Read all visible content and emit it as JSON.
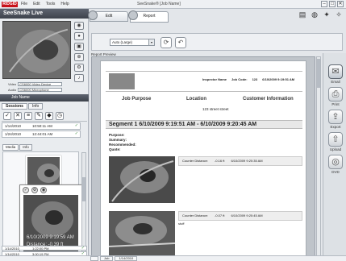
{
  "app": {
    "brand": "RIDGID",
    "menu": [
      "File",
      "Edit",
      "Tools",
      "Help"
    ],
    "window_title": "SeeSnake® [Job Name]",
    "window_buttons": [
      "‒",
      "□",
      "✕"
    ]
  },
  "live": {
    "title": "SeeSnake Live",
    "video_label": "Video",
    "video_source": "CS6000 Video Device",
    "audio_label": "Audio",
    "audio_source": "CS6000 Microphone"
  },
  "job": {
    "header": "Job Name",
    "tabs": [
      "Sessions",
      "Info"
    ],
    "sessions_top": [
      {
        "date": "1/14/2010",
        "time": "10:50:11 AM"
      },
      {
        "date": "1/24/2010",
        "time": "12:44:01 AM"
      }
    ],
    "media_tabs": [
      "Media",
      "Info"
    ],
    "thumb_caption_date": "6/10/2009 9:19:59 AM",
    "thumb_caption_distance": "Distance: -0.39 ft",
    "sessions_bottom": [
      {
        "date": "1/14/2010",
        "time": "1:22:00 PM"
      },
      {
        "date": "1/14/2010",
        "time": "3:00:19 PM"
      }
    ]
  },
  "main": {
    "tabs": [
      "Edit",
      "Report"
    ],
    "active_tab": "Report",
    "report_template": "Auto (Large)",
    "preview_label": "Report Preview"
  },
  "report": {
    "header_fields": [
      "Inspector Name",
      "Job Code:",
      "123",
      "6/10/2009 9:19:51 AM"
    ],
    "col_job_purpose": "Job Purpose",
    "col_location": "Location",
    "col_customer": "Customer Information",
    "address": "123 street street",
    "segment_title": "Segment 1  6/10/2009 9:19:51 AM  -  6/10/2009 9:20:45 AM",
    "segment_fields": [
      "Purpose:",
      "Summary:",
      "Recommended:",
      "Quote:"
    ],
    "observations": [
      {
        "counter": "Counter Distance:",
        "distance": "-0.16 ft",
        "time": "6/10/2009 9:20:35 AM",
        "note": ""
      },
      {
        "counter": "Counter Distance:",
        "distance": "-0.07 ft",
        "time": "6/10/2009 9:20:45 AM",
        "note": "stuff"
      }
    ]
  },
  "actions": [
    {
      "icon": "email-icon",
      "label": "Email"
    },
    {
      "icon": "print-icon",
      "label": "Print"
    },
    {
      "icon": "export-icon",
      "label": "Export"
    },
    {
      "icon": "upload-icon",
      "label": "Upload"
    },
    {
      "icon": "dvd-icon",
      "label": "DVD"
    }
  ],
  "status_tabs": [
    "",
    "Job",
    "1/14/2010"
  ]
}
